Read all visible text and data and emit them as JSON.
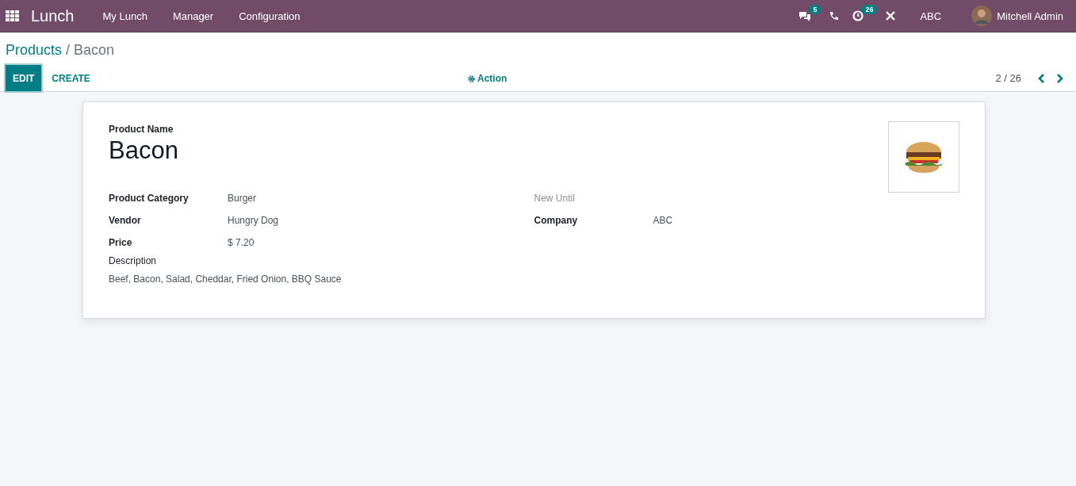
{
  "navbar": {
    "app": "Lunch",
    "menus": [
      "My Lunch",
      "Manager",
      "Configuration"
    ],
    "messages_badge": "5",
    "activities_badge": "26",
    "company": "ABC",
    "user": "Mitchell Admin"
  },
  "breadcrumb": {
    "parent": "Products",
    "separator": "/",
    "current": "Bacon"
  },
  "buttons": [
    {
      "label": "EDIT",
      "kind": "primary"
    },
    {
      "label": "CREATE",
      "kind": "link"
    }
  ],
  "action": "Action",
  "pager": {
    "value": "2 / 26"
  },
  "form": {
    "name_label": "Product Name",
    "name": "Bacon",
    "left_fields": [
      {
        "label": "Product Category",
        "value": "Burger",
        "muted": false
      },
      {
        "label": "Vendor",
        "value": "Hungry Dog",
        "muted": false
      },
      {
        "label": "Price",
        "value": "$ 7.20",
        "muted": false
      }
    ],
    "right_fields": [
      {
        "label": "New Until",
        "muted": true
      },
      {
        "label": "Company",
        "value": "ABC",
        "muted": false
      }
    ],
    "description_label": "Description",
    "description": "Beef, Bacon, Salad, Cheddar, Fried Onion, BBQ Sauce"
  }
}
